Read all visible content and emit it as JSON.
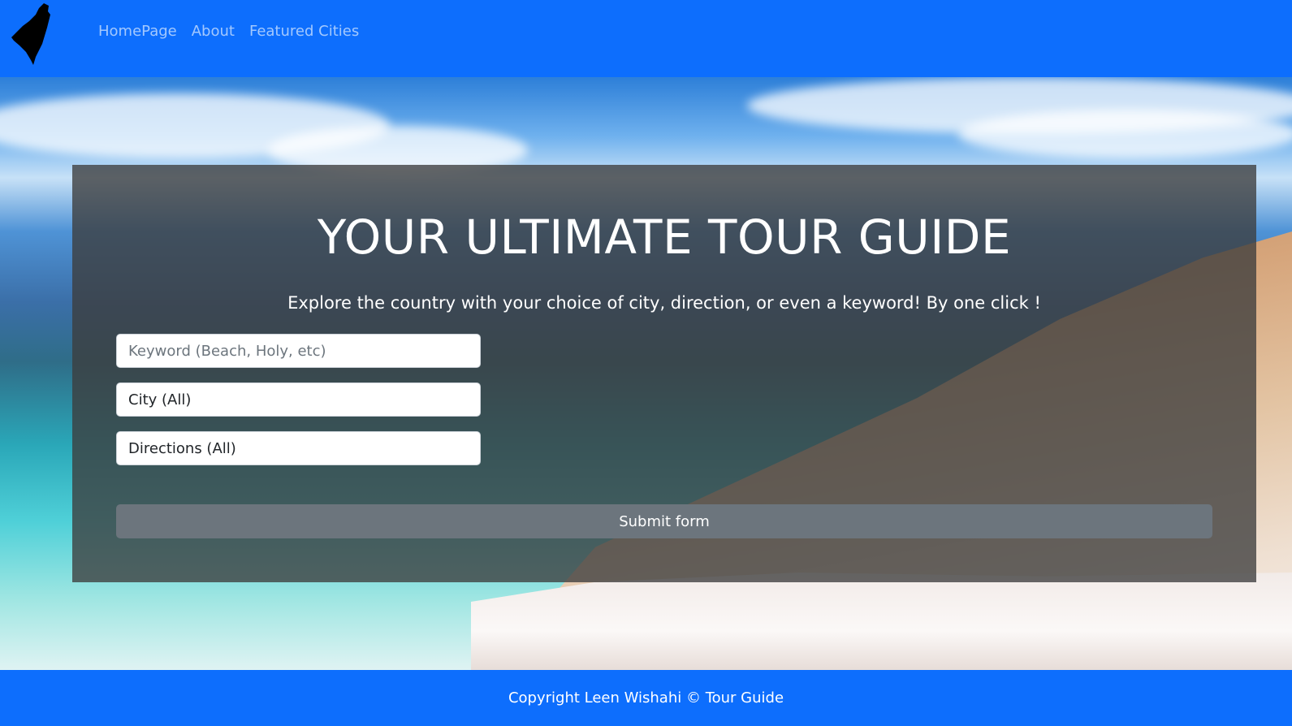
{
  "nav": {
    "brand_icon": "map-silhouette-icon",
    "links": [
      "HomePage",
      "About",
      "Featured Cities"
    ]
  },
  "hero": {
    "title": "YOUR ULTIMATE TOUR GUIDE",
    "subtitle": "Explore the country with your choice of city, direction, or even a keyword! By one click !",
    "keyword_placeholder": "Keyword (Beach, Holy, etc)",
    "city_value": "City (All)",
    "direction_value": "Directions (All)",
    "submit_label": "Submit form"
  },
  "footer": {
    "copyright": "Copyright Leen Wishahi © Tour Guide"
  },
  "colors": {
    "nav_bg": "#0d6efd",
    "button_bg": "#6c757d",
    "card_overlay": "#3c3c3c"
  }
}
